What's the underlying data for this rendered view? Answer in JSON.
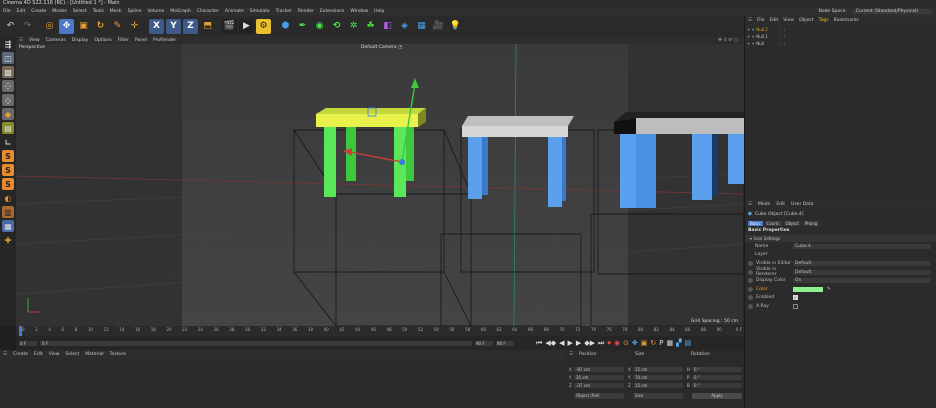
{
  "window": {
    "title": "Cinema 4D S22.116 (RC) - [Untitled 1 *] - Main"
  },
  "menubar": {
    "items": [
      "File",
      "Edit",
      "Create",
      "Modes",
      "Select",
      "Tools",
      "Mesh",
      "Spline",
      "Volume",
      "MoGraph",
      "Character",
      "Animate",
      "Simulate",
      "Tracker",
      "Render",
      "Extensions",
      "Window",
      "Help"
    ],
    "node_space_label": "Node Space:",
    "node_space_value": "Current (Standard/Physical)"
  },
  "viewport": {
    "menu": [
      "View",
      "Cameras",
      "Display",
      "Options",
      "Filter",
      "Panel",
      "ProRender"
    ],
    "label": "Perspective",
    "camera": "Default Camera",
    "grid_spacing": "Grid Spacing : 50 cm"
  },
  "timeline": {
    "ticks": [
      "0",
      "2",
      "4",
      "6",
      "8",
      "10",
      "12",
      "14",
      "16",
      "18",
      "20",
      "22",
      "24",
      "26",
      "28",
      "30",
      "32",
      "34",
      "36",
      "38",
      "40",
      "42",
      "44",
      "46",
      "48",
      "50",
      "52",
      "54",
      "56",
      "58",
      "60",
      "62",
      "64",
      "66",
      "68",
      "70",
      "72",
      "74",
      "76",
      "78",
      "80",
      "82",
      "84",
      "86",
      "88",
      "90"
    ],
    "end_marker": "0 F"
  },
  "transport": {
    "start": "0 F",
    "current": "0 F",
    "end": "90 F",
    "end2": "90 F"
  },
  "material_menu": [
    "Create",
    "Edit",
    "View",
    "Select",
    "Material",
    "Texture"
  ],
  "coords": {
    "headers": [
      "Position",
      "Size",
      "Rotation"
    ],
    "rows": [
      {
        "axis": "X",
        "pos": "-87 cm",
        "size_axis": "X",
        "size": "15 cm",
        "rot_axis": "H",
        "rot": "0 °"
      },
      {
        "axis": "Y",
        "pos": "35 cm",
        "size_axis": "Y",
        "size": "70 cm",
        "rot_axis": "P",
        "rot": "0 °"
      },
      {
        "axis": "Z",
        "pos": "-37 cm",
        "size_axis": "Z",
        "size": "15 cm",
        "rot_axis": "B",
        "rot": "0 °"
      }
    ],
    "mode": "Object (Rel)",
    "size_mode": "Size",
    "apply": "Apply"
  },
  "object_manager": {
    "menu": [
      "File",
      "Edit",
      "View",
      "Object",
      "Tags",
      "Bookmarks"
    ],
    "objects": [
      {
        "name": "Null.2",
        "color": "#e0a020"
      },
      {
        "name": "Null.1",
        "color": "#cfcfcf"
      },
      {
        "name": "Null",
        "color": "#cfcfcf"
      }
    ]
  },
  "attributes": {
    "menu": [
      "Mode",
      "Edit",
      "User Data"
    ],
    "object_title": "Cube Object [Cube.4]",
    "tabs": [
      "Basic",
      "Coord.",
      "Object",
      "Phong"
    ],
    "section": "Basic Properties",
    "subsection": "Icon Settings",
    "props": [
      {
        "label": "Name",
        "value": "Cube.4"
      },
      {
        "label": "Layer",
        "value": ""
      },
      {
        "label": "Visible in Editor",
        "value": "Default"
      },
      {
        "label": "Visible in Renderer",
        "value": "Default"
      },
      {
        "label": "Display Color",
        "value": "On"
      },
      {
        "label": "Color",
        "value": ""
      },
      {
        "label": "Enabled",
        "value": ""
      },
      {
        "label": "X-Ray",
        "value": ""
      }
    ],
    "color_swatch": "#8ef08e"
  }
}
